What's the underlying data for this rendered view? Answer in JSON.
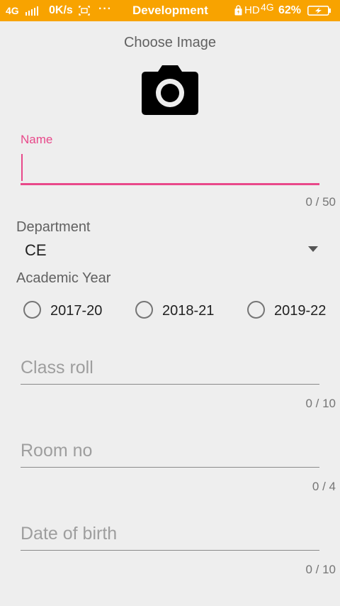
{
  "status_bar": {
    "network_left": "4G",
    "speed": "0K/s",
    "more": "···",
    "app_title": "Development",
    "hd": "HD",
    "network_right": "4G",
    "battery_percent": "62%"
  },
  "choose_image": {
    "label": "Choose Image",
    "icon": "camera-icon"
  },
  "name_field": {
    "label": "Name",
    "value": "",
    "counter": "0 / 50",
    "accent_color": "#e8498a"
  },
  "department": {
    "label": "Department",
    "selected": "CE"
  },
  "academic_year": {
    "label": "Academic Year",
    "options": [
      "2017-20",
      "2018-21",
      "2019-22"
    ]
  },
  "class_roll": {
    "placeholder": "Class roll",
    "counter": "0 / 10"
  },
  "room_no": {
    "placeholder": "Room no",
    "counter": "0 / 4"
  },
  "date_of_birth": {
    "placeholder": "Date of birth",
    "counter": "0 / 10"
  },
  "colors": {
    "status_bar": "#f8a300",
    "accent": "#e8498a",
    "background": "#eeeeee"
  }
}
